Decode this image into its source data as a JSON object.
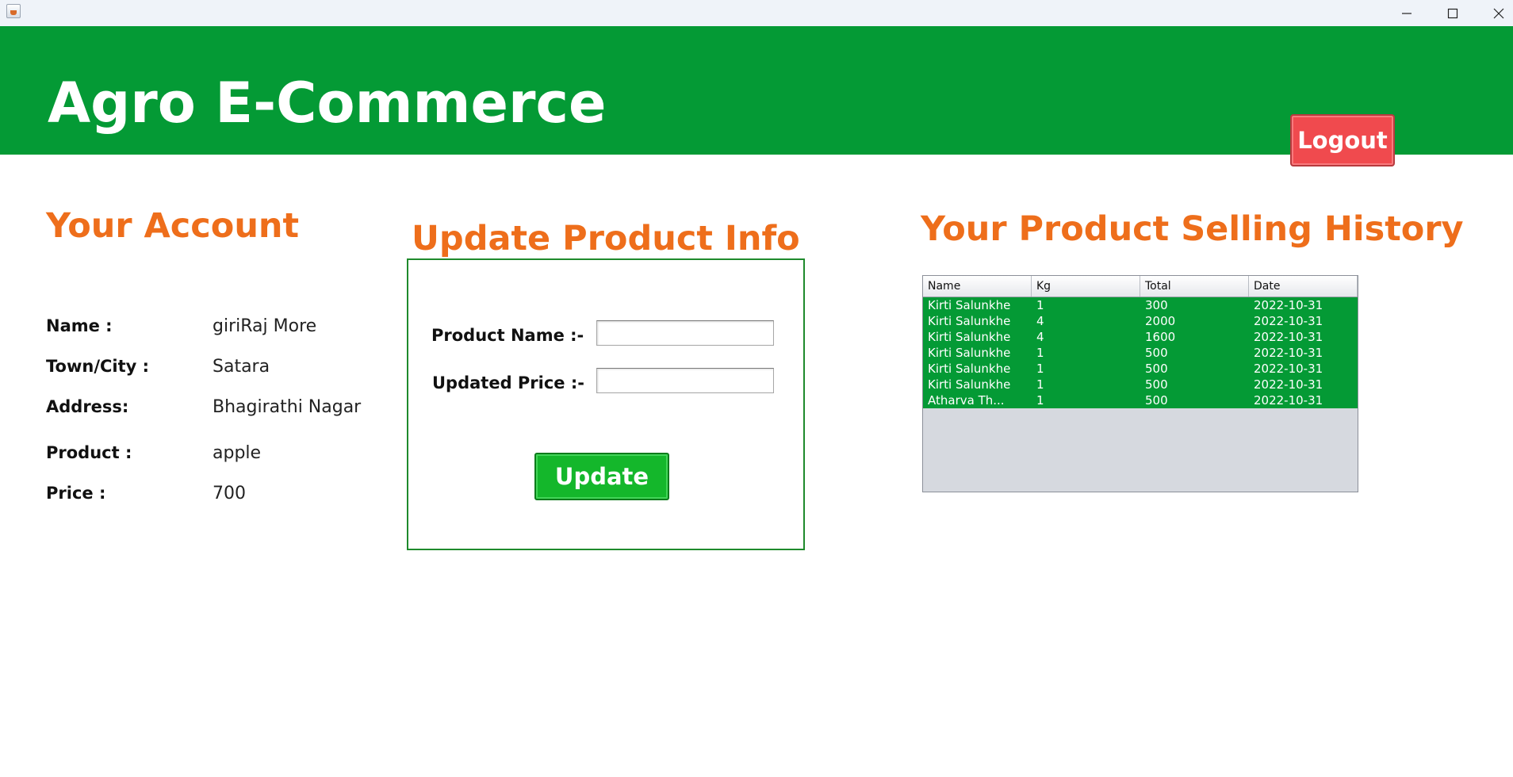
{
  "window": {
    "app_icon": "java-icon",
    "controls": [
      "minimize-icon",
      "maximize-icon",
      "close-icon"
    ]
  },
  "header": {
    "title": "Agro E-Commerce",
    "logout_label": "Logout",
    "background": "#049a35",
    "logout_color": "#f04a4e"
  },
  "account": {
    "heading": "Your Account",
    "fields": [
      {
        "label": "Name :",
        "value": "giriRaj More"
      },
      {
        "label": "Town/City :",
        "value": "Satara"
      },
      {
        "label": "Address:",
        "value": "Bhagirathi Nagar"
      },
      {
        "label": "Product :",
        "value": "apple"
      },
      {
        "label": "Price :",
        "value": "700"
      }
    ]
  },
  "update_form": {
    "heading": "Update Product Info",
    "product_name_label": "Product Name :-",
    "product_name_value": "",
    "updated_price_label": "Updated Price :-",
    "updated_price_value": "",
    "update_label": "Update",
    "button_color": "#14b72b"
  },
  "history": {
    "heading": "Your Product Selling History",
    "columns": [
      "Name",
      "Kg",
      "Total",
      "Date"
    ],
    "rows": [
      [
        "Kirti Salunkhe",
        "1",
        "300",
        "2022-10-31"
      ],
      [
        "Kirti Salunkhe",
        "4",
        "2000",
        "2022-10-31"
      ],
      [
        "Kirti Salunkhe",
        "4",
        "1600",
        "2022-10-31"
      ],
      [
        "Kirti Salunkhe",
        "1",
        "500",
        "2022-10-31"
      ],
      [
        "Kirti Salunkhe",
        "1",
        "500",
        "2022-10-31"
      ],
      [
        "Kirti Salunkhe",
        "1",
        "500",
        "2022-10-31"
      ],
      [
        "Atharva Th...",
        "1",
        "500",
        "2022-10-31"
      ]
    ],
    "selected_row_color": "#049a35"
  },
  "theme": {
    "heading_color": "#ee6e1b"
  }
}
